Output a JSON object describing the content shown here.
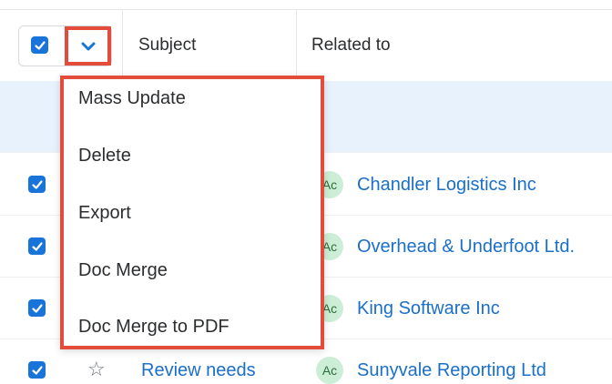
{
  "header": {
    "subject_label": "Subject",
    "related_label": "Related to"
  },
  "dropdown": {
    "items": [
      "Mass Update",
      "Delete",
      "Export",
      "Doc Merge",
      "Doc Merge to PDF"
    ]
  },
  "rows": [
    {
      "subject": "",
      "avatar": "Ac",
      "related": "Chandler Logistics Inc",
      "checked": true
    },
    {
      "subject": "",
      "avatar": "Ac",
      "related": "Overhead & Underfoot Ltd.",
      "checked": true
    },
    {
      "subject": "",
      "avatar": "Ac",
      "related": "King Software Inc",
      "checked": true
    },
    {
      "subject": "Review needs",
      "avatar": "Ac",
      "related": "Sunyvale Reporting Ltd",
      "checked": true
    }
  ],
  "colors": {
    "accent": "#1874d8",
    "link": "#1a6fc9",
    "highlight": "#e34b3a",
    "row_highlight": "#e8f2fd",
    "avatar_bg": "#cdeed6"
  },
  "icons": {
    "checkbox": "check-icon",
    "caret": "chevron-down-icon",
    "favorite": "star-icon"
  }
}
